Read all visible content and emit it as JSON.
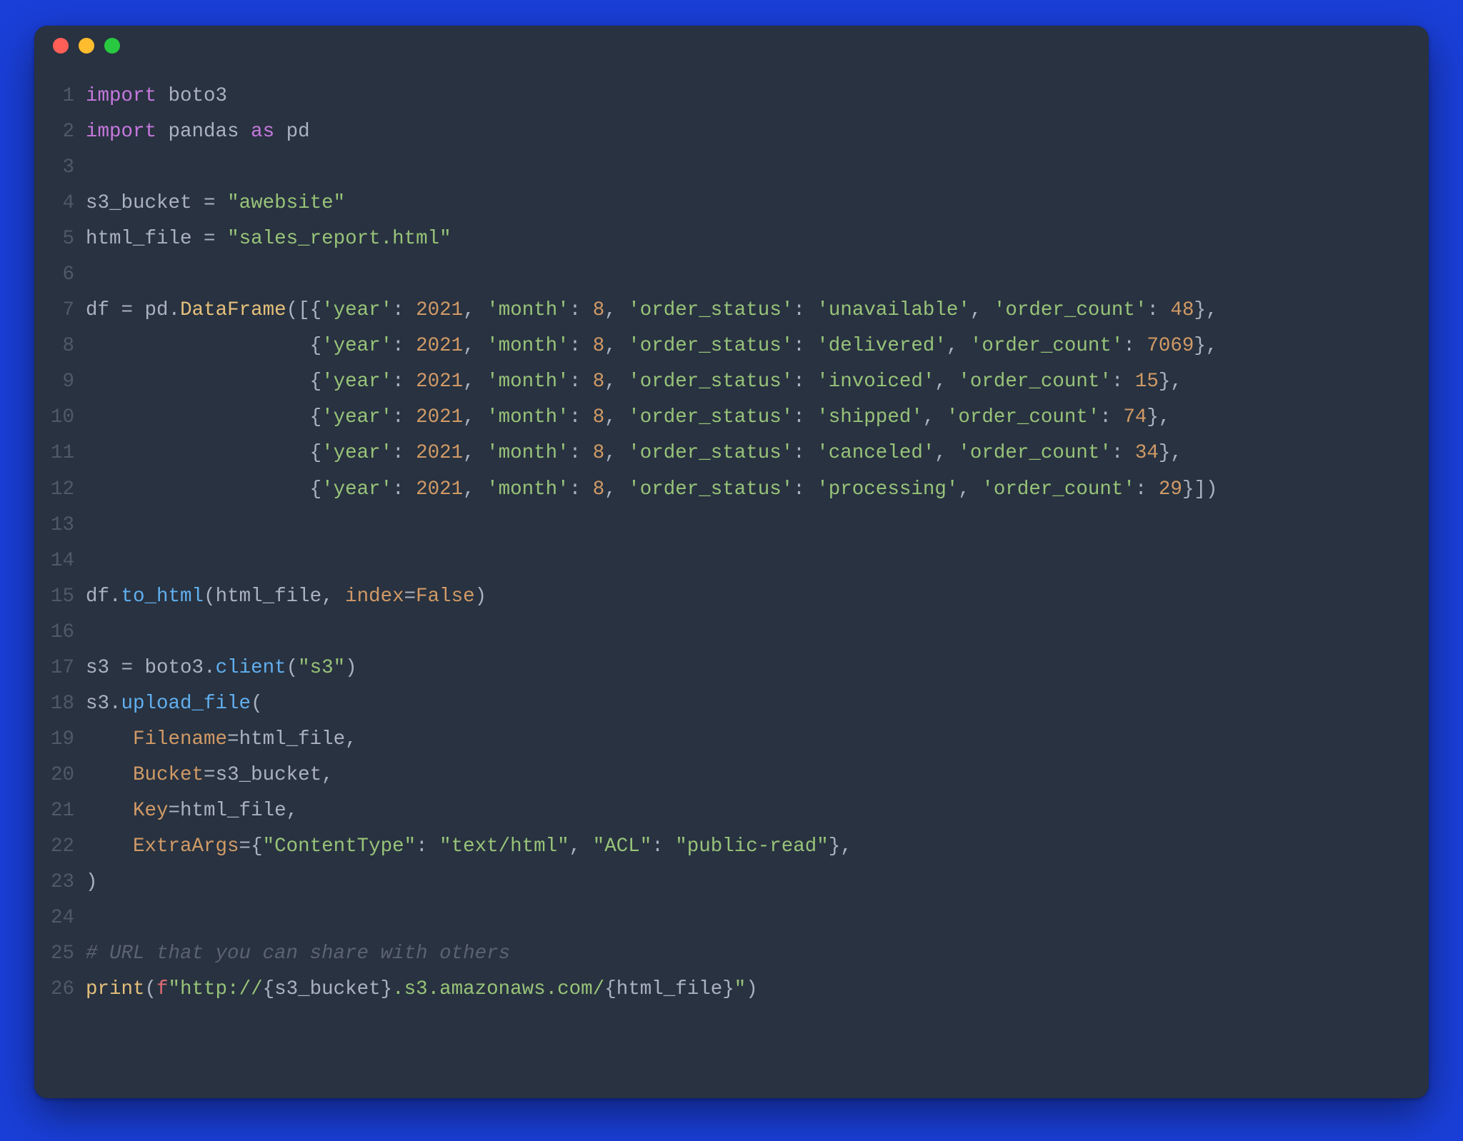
{
  "window": {
    "traffic_lights": {
      "red": "#ff5f57",
      "yellow": "#febc2e",
      "green": "#28c840"
    }
  },
  "code": {
    "lines": [
      {
        "n": 1,
        "tokens": [
          [
            "kw",
            "import"
          ],
          [
            "sp",
            " "
          ],
          [
            "mod",
            "boto3"
          ]
        ]
      },
      {
        "n": 2,
        "tokens": [
          [
            "kw",
            "import"
          ],
          [
            "sp",
            " "
          ],
          [
            "mod",
            "pandas"
          ],
          [
            "sp",
            " "
          ],
          [
            "kw",
            "as"
          ],
          [
            "sp",
            " "
          ],
          [
            "mod",
            "pd"
          ]
        ]
      },
      {
        "n": 3,
        "tokens": []
      },
      {
        "n": 4,
        "tokens": [
          [
            "mod",
            "s3_bucket "
          ],
          [
            "op",
            "="
          ],
          [
            "sp",
            " "
          ],
          [
            "str",
            "\"awebsite\""
          ]
        ]
      },
      {
        "n": 5,
        "tokens": [
          [
            "mod",
            "html_file "
          ],
          [
            "op",
            "="
          ],
          [
            "sp",
            " "
          ],
          [
            "str",
            "\"sales_report.html\""
          ]
        ]
      },
      {
        "n": 6,
        "tokens": []
      },
      {
        "n": 7,
        "tokens": [
          [
            "mod",
            "df "
          ],
          [
            "op",
            "="
          ],
          [
            "sp",
            " "
          ],
          [
            "mod",
            "pd"
          ],
          [
            "pun",
            "."
          ],
          [
            "cls",
            "DataFrame"
          ],
          [
            "pun",
            "([{"
          ],
          [
            "str",
            "'year'"
          ],
          [
            "pun",
            ": "
          ],
          [
            "num",
            "2021"
          ],
          [
            "pun",
            ", "
          ],
          [
            "str",
            "'month'"
          ],
          [
            "pun",
            ": "
          ],
          [
            "num",
            "8"
          ],
          [
            "pun",
            ", "
          ],
          [
            "str",
            "'order_status'"
          ],
          [
            "pun",
            ": "
          ],
          [
            "str",
            "'unavailable'"
          ],
          [
            "pun",
            ", "
          ],
          [
            "str",
            "'order_count'"
          ],
          [
            "pun",
            ": "
          ],
          [
            "num",
            "48"
          ],
          [
            "pun",
            "},"
          ]
        ]
      },
      {
        "n": 8,
        "tokens": [
          [
            "sp",
            "                   "
          ],
          [
            "pun",
            "{"
          ],
          [
            "str",
            "'year'"
          ],
          [
            "pun",
            ": "
          ],
          [
            "num",
            "2021"
          ],
          [
            "pun",
            ", "
          ],
          [
            "str",
            "'month'"
          ],
          [
            "pun",
            ": "
          ],
          [
            "num",
            "8"
          ],
          [
            "pun",
            ", "
          ],
          [
            "str",
            "'order_status'"
          ],
          [
            "pun",
            ": "
          ],
          [
            "str",
            "'delivered'"
          ],
          [
            "pun",
            ", "
          ],
          [
            "str",
            "'order_count'"
          ],
          [
            "pun",
            ": "
          ],
          [
            "num",
            "7069"
          ],
          [
            "pun",
            "},"
          ]
        ]
      },
      {
        "n": 9,
        "tokens": [
          [
            "sp",
            "                   "
          ],
          [
            "pun",
            "{"
          ],
          [
            "str",
            "'year'"
          ],
          [
            "pun",
            ": "
          ],
          [
            "num",
            "2021"
          ],
          [
            "pun",
            ", "
          ],
          [
            "str",
            "'month'"
          ],
          [
            "pun",
            ": "
          ],
          [
            "num",
            "8"
          ],
          [
            "pun",
            ", "
          ],
          [
            "str",
            "'order_status'"
          ],
          [
            "pun",
            ": "
          ],
          [
            "str",
            "'invoiced'"
          ],
          [
            "pun",
            ", "
          ],
          [
            "str",
            "'order_count'"
          ],
          [
            "pun",
            ": "
          ],
          [
            "num",
            "15"
          ],
          [
            "pun",
            "},"
          ]
        ]
      },
      {
        "n": 10,
        "tokens": [
          [
            "sp",
            "                   "
          ],
          [
            "pun",
            "{"
          ],
          [
            "str",
            "'year'"
          ],
          [
            "pun",
            ": "
          ],
          [
            "num",
            "2021"
          ],
          [
            "pun",
            ", "
          ],
          [
            "str",
            "'month'"
          ],
          [
            "pun",
            ": "
          ],
          [
            "num",
            "8"
          ],
          [
            "pun",
            ", "
          ],
          [
            "str",
            "'order_status'"
          ],
          [
            "pun",
            ": "
          ],
          [
            "str",
            "'shipped'"
          ],
          [
            "pun",
            ", "
          ],
          [
            "str",
            "'order_count'"
          ],
          [
            "pun",
            ": "
          ],
          [
            "num",
            "74"
          ],
          [
            "pun",
            "},"
          ]
        ]
      },
      {
        "n": 11,
        "tokens": [
          [
            "sp",
            "                   "
          ],
          [
            "pun",
            "{"
          ],
          [
            "str",
            "'year'"
          ],
          [
            "pun",
            ": "
          ],
          [
            "num",
            "2021"
          ],
          [
            "pun",
            ", "
          ],
          [
            "str",
            "'month'"
          ],
          [
            "pun",
            ": "
          ],
          [
            "num",
            "8"
          ],
          [
            "pun",
            ", "
          ],
          [
            "str",
            "'order_status'"
          ],
          [
            "pun",
            ": "
          ],
          [
            "str",
            "'canceled'"
          ],
          [
            "pun",
            ", "
          ],
          [
            "str",
            "'order_count'"
          ],
          [
            "pun",
            ": "
          ],
          [
            "num",
            "34"
          ],
          [
            "pun",
            "},"
          ]
        ]
      },
      {
        "n": 12,
        "tokens": [
          [
            "sp",
            "                   "
          ],
          [
            "pun",
            "{"
          ],
          [
            "str",
            "'year'"
          ],
          [
            "pun",
            ": "
          ],
          [
            "num",
            "2021"
          ],
          [
            "pun",
            ", "
          ],
          [
            "str",
            "'month'"
          ],
          [
            "pun",
            ": "
          ],
          [
            "num",
            "8"
          ],
          [
            "pun",
            ", "
          ],
          [
            "str",
            "'order_status'"
          ],
          [
            "pun",
            ": "
          ],
          [
            "str",
            "'processing'"
          ],
          [
            "pun",
            ", "
          ],
          [
            "str",
            "'order_count'"
          ],
          [
            "pun",
            ": "
          ],
          [
            "num",
            "29"
          ],
          [
            "pun",
            "}])"
          ]
        ]
      },
      {
        "n": 13,
        "tokens": []
      },
      {
        "n": 14,
        "tokens": []
      },
      {
        "n": 15,
        "tokens": [
          [
            "mod",
            "df"
          ],
          [
            "pun",
            "."
          ],
          [
            "fn",
            "to_html"
          ],
          [
            "pun",
            "("
          ],
          [
            "mod",
            "html_file"
          ],
          [
            "pun",
            ", "
          ],
          [
            "arg",
            "index"
          ],
          [
            "op",
            "="
          ],
          [
            "cnst",
            "False"
          ],
          [
            "pun",
            ")"
          ]
        ]
      },
      {
        "n": 16,
        "tokens": []
      },
      {
        "n": 17,
        "tokens": [
          [
            "mod",
            "s3 "
          ],
          [
            "op",
            "="
          ],
          [
            "sp",
            " "
          ],
          [
            "mod",
            "boto3"
          ],
          [
            "pun",
            "."
          ],
          [
            "fn",
            "client"
          ],
          [
            "pun",
            "("
          ],
          [
            "str",
            "\"s3\""
          ],
          [
            "pun",
            ")"
          ]
        ]
      },
      {
        "n": 18,
        "tokens": [
          [
            "mod",
            "s3"
          ],
          [
            "pun",
            "."
          ],
          [
            "fn",
            "upload_file"
          ],
          [
            "pun",
            "("
          ]
        ]
      },
      {
        "n": 19,
        "tokens": [
          [
            "sp",
            "    "
          ],
          [
            "arg",
            "Filename"
          ],
          [
            "op",
            "="
          ],
          [
            "mod",
            "html_file"
          ],
          [
            "pun",
            ","
          ]
        ]
      },
      {
        "n": 20,
        "tokens": [
          [
            "sp",
            "    "
          ],
          [
            "arg",
            "Bucket"
          ],
          [
            "op",
            "="
          ],
          [
            "mod",
            "s3_bucket"
          ],
          [
            "pun",
            ","
          ]
        ]
      },
      {
        "n": 21,
        "tokens": [
          [
            "sp",
            "    "
          ],
          [
            "arg",
            "Key"
          ],
          [
            "op",
            "="
          ],
          [
            "mod",
            "html_file"
          ],
          [
            "pun",
            ","
          ]
        ]
      },
      {
        "n": 22,
        "tokens": [
          [
            "sp",
            "    "
          ],
          [
            "arg",
            "ExtraArgs"
          ],
          [
            "op",
            "="
          ],
          [
            "pun",
            "{"
          ],
          [
            "str",
            "\"ContentType\""
          ],
          [
            "pun",
            ": "
          ],
          [
            "str",
            "\"text/html\""
          ],
          [
            "pun",
            ", "
          ],
          [
            "str",
            "\"ACL\""
          ],
          [
            "pun",
            ": "
          ],
          [
            "str",
            "\"public-read\""
          ],
          [
            "pun",
            "},"
          ]
        ]
      },
      {
        "n": 23,
        "tokens": [
          [
            "pun",
            ")"
          ]
        ]
      },
      {
        "n": 24,
        "tokens": []
      },
      {
        "n": 25,
        "tokens": [
          [
            "cmt",
            "# URL that you can share with others"
          ]
        ]
      },
      {
        "n": 26,
        "tokens": [
          [
            "cls",
            "print"
          ],
          [
            "pun",
            "("
          ],
          [
            "nm",
            "f"
          ],
          [
            "str",
            "\"http://"
          ],
          [
            "pun",
            "{"
          ],
          [
            "mod",
            "s3_bucket"
          ],
          [
            "pun",
            "}"
          ],
          [
            "str",
            ".s3.amazonaws.com/"
          ],
          [
            "pun",
            "{"
          ],
          [
            "mod",
            "html_file"
          ],
          [
            "pun",
            "}"
          ],
          [
            "str",
            "\""
          ],
          [
            "pun",
            ")"
          ]
        ]
      }
    ]
  }
}
